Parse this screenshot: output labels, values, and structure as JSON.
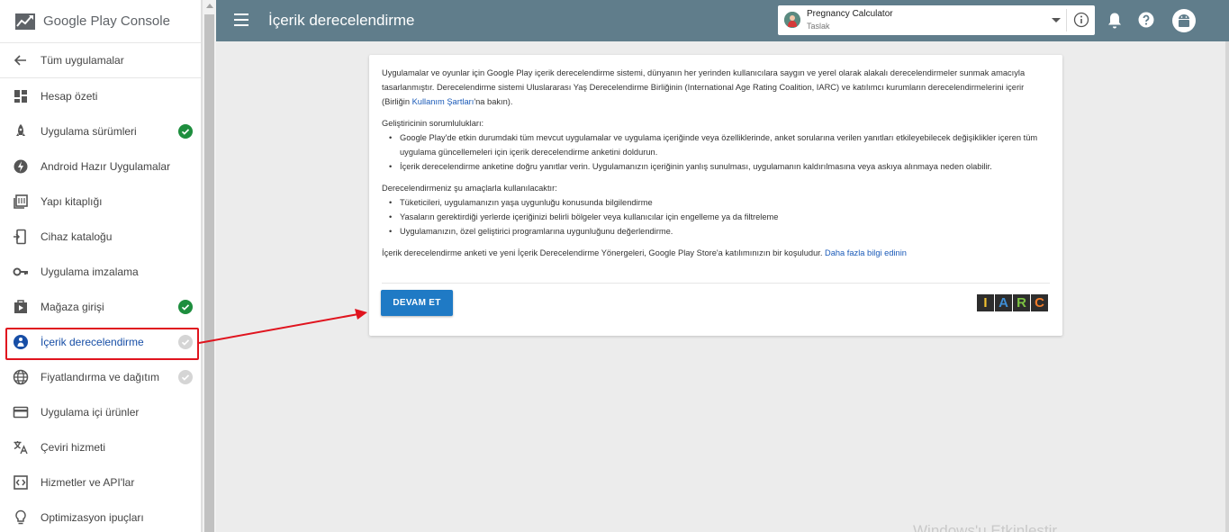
{
  "brand": {
    "logo_google": "Google Play",
    "logo_console": "Console"
  },
  "sidebar": {
    "back_label": "Tüm uygulamalar",
    "items": [
      {
        "label": "Hesap özeti",
        "icon": "dashboard-icon",
        "status": "none"
      },
      {
        "label": "Uygulama sürümleri",
        "icon": "rocket-icon",
        "status": "complete"
      },
      {
        "label": "Android Hazır Uygulamalar",
        "icon": "instant-app-icon",
        "status": "none"
      },
      {
        "label": "Yapı kitaplığı",
        "icon": "library-icon",
        "status": "none"
      },
      {
        "label": "Cihaz kataloğu",
        "icon": "device-catalog-icon",
        "status": "none"
      },
      {
        "label": "Uygulama imzalama",
        "icon": "key-icon",
        "status": "none"
      },
      {
        "label": "Mağaza girişi",
        "icon": "store-listing-icon",
        "status": "complete"
      },
      {
        "label": "İçerik derecelendirme",
        "icon": "content-rating-icon",
        "status": "pending",
        "active": true
      },
      {
        "label": "Fiyatlandırma ve dağıtım",
        "icon": "globe-icon",
        "status": "pending"
      },
      {
        "label": "Uygulama içi ürünler",
        "icon": "credit-card-icon",
        "status": "none"
      },
      {
        "label": "Çeviri hizmeti",
        "icon": "translate-icon",
        "status": "none"
      },
      {
        "label": "Hizmetler ve API'lar",
        "icon": "code-icon",
        "status": "none"
      },
      {
        "label": "Optimizasyon ipuçları",
        "icon": "lightbulb-icon",
        "status": "none"
      }
    ]
  },
  "topbar": {
    "title": "İçerik derecelendirme",
    "app_name": "Pregnancy Calculator",
    "app_status": "Taslak"
  },
  "content": {
    "intro_1": "Uygulamalar ve oyunlar için Google Play içerik derecelendirme sistemi, dünyanın her yerinden kullanıcılara saygın ve yerel olarak alakalı derecelendirmeler sunmak amacıyla tasarlanmıştır. Derecelendirme sistemi Uluslararası Yaş Derecelendirme Birliğinin (International Age Rating Coalition, IARC) ve katılımcı kurumların derecelendirmelerini içerir (Birliğin ",
    "intro_link": "Kullanım Şartları",
    "intro_2": "'na bakın).",
    "responsibilities_heading": "Geliştiricinin sorumlulukları:",
    "responsibilities": [
      "Google Play'de etkin durumdaki tüm mevcut uygulamalar ve uygulama içeriğinde veya özelliklerinde, anket sorularına verilen yanıtları etkileyebilecek değişiklikler içeren tüm uygulama güncellemeleri için içerik derecelendirme anketini doldurun.",
      "İçerik derecelendirme anketine doğru yanıtlar verin. Uygulamanızın içeriğinin yanlış sunulması, uygulamanın kaldırılmasına veya askıya alınmaya neden olabilir."
    ],
    "usage_heading": "Derecelendirmeniz şu amaçlarla kullanılacaktır:",
    "usage": [
      "Tüketicileri, uygulamanızın yaşa uygunluğu konusunda bilgilendirme",
      "Yasaların gerektirdiği yerlerde içeriğinizi belirli bölgeler veya kullanıcılar için engelleme ya da filtreleme",
      "Uygulamanızın, özel geliştirici programlarına uygunluğunu değerlendirme."
    ],
    "footer_text": "İçerik derecelendirme anketi ve yeni İçerik Derecelendirme Yönergeleri, Google Play Store'a katılımınızın bir koşuludur. ",
    "footer_link": "Daha fazla bilgi edinin",
    "continue_label": "DEVAM ET",
    "iarc_letters": [
      {
        "letter": "I",
        "color": "#f2c230"
      },
      {
        "letter": "A",
        "color": "#3f8fd6"
      },
      {
        "letter": "R",
        "color": "#7cc242"
      },
      {
        "letter": "C",
        "color": "#ef7b2a"
      }
    ]
  },
  "watermark": "Windows'u Etkinleştir",
  "colors": {
    "topbar": "#607d8b",
    "primary": "#1f7ac5",
    "complete": "#1e8e3e",
    "pending": "#d5d5d5",
    "annotation": "#e0141e"
  }
}
